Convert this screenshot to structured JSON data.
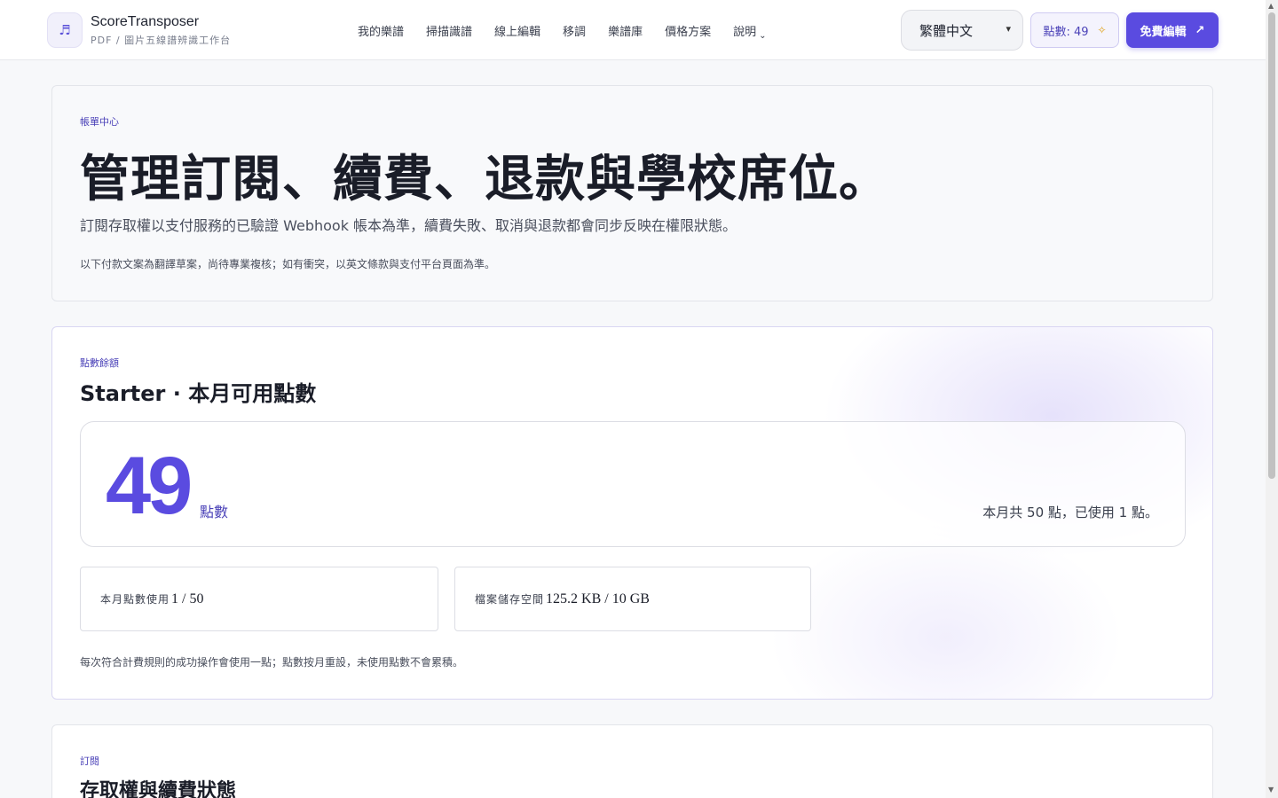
{
  "header": {
    "logo_glyph": "♬",
    "brand_name": "ScoreTransposer",
    "brand_sub": "PDF / 圖片五線譜辨識工作台",
    "nav": [
      {
        "label": "我的樂譜"
      },
      {
        "label": "掃描識譜"
      },
      {
        "label": "線上編輯"
      },
      {
        "label": "移調"
      },
      {
        "label": "樂譜庫"
      },
      {
        "label": "價格方案"
      },
      {
        "label": "說明"
      }
    ],
    "language": "繁體中文",
    "points_label": "點數: 49",
    "free_button": "免費編輯"
  },
  "hero": {
    "eyebrow": "帳單中心",
    "title": "管理訂閱、續費、退款與學校席位。",
    "description": "訂閱存取權以支付服務的已驗證 Webhook 帳本為準，續費失敗、取消與退款都會同步反映在權限狀態。",
    "note": "以下付款文案為翻譯草案，尚待專業複核；如有衝突，以英文條款與支付平台頁面為準。"
  },
  "credits": {
    "eyebrow": "點數餘額",
    "title": "Starter · 本月可用點數",
    "balance": "49",
    "balance_unit": "點數",
    "balance_note": "本月共 50 點，已使用 1 點。",
    "stats": [
      {
        "label": "本月點數使用",
        "value": "1 / 50"
      },
      {
        "label": "檔案儲存空間",
        "value": "125.2 KB / 10 GB"
      }
    ],
    "footnote": "每次符合計費規則的成功操作會使用一點；點數按月重設，未使用點數不會累積。"
  },
  "subscription": {
    "eyebrow": "訂閱",
    "title": "存取權與續費狀態"
  },
  "colors": {
    "accent": "#5a4be0",
    "background": "#f7f8fa"
  }
}
